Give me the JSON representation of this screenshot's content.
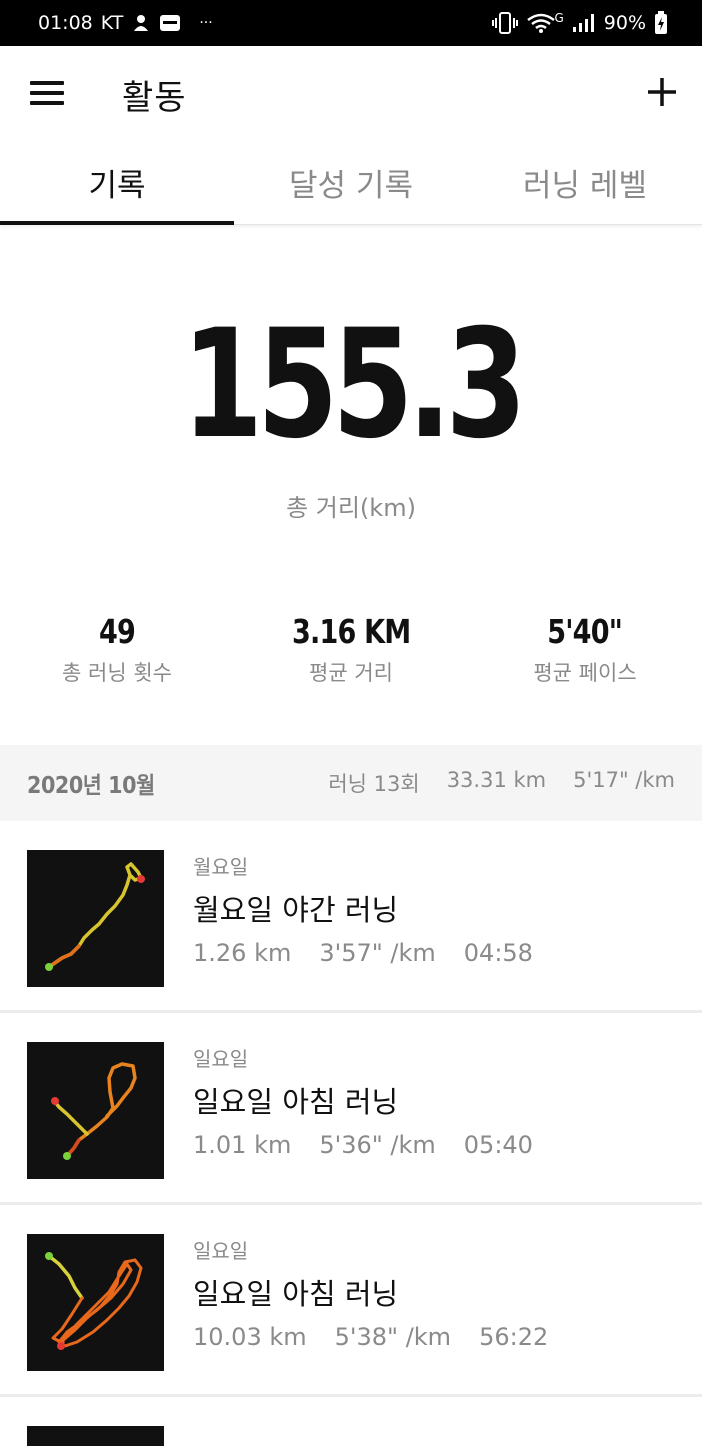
{
  "status_bar": {
    "time": "01:08",
    "carrier": "KT",
    "more": "···",
    "network": "G",
    "battery": "90%"
  },
  "app_bar": {
    "title": "활동"
  },
  "tabs": [
    {
      "label": "기록",
      "active": true
    },
    {
      "label": "달성 기록",
      "active": false
    },
    {
      "label": "러닝 레벨",
      "active": false
    }
  ],
  "summary": {
    "total_distance": "155.3",
    "total_label": "총 거리(km)"
  },
  "stats": [
    {
      "value": "49",
      "label": "총 러닝 횟수"
    },
    {
      "value": "3.16 KM",
      "label": "평균 거리"
    },
    {
      "value": "5'40\"",
      "label": "평균 페이스"
    }
  ],
  "month": {
    "label": "2020년 10월",
    "runs": "러닝 13회",
    "distance": "33.31 km",
    "pace": "5'17\" /km"
  },
  "activities": [
    {
      "day": "월요일",
      "title": "월요일 야간 러닝",
      "distance": "1.26 km",
      "pace": "3'57\" /km",
      "duration": "04:58"
    },
    {
      "day": "일요일",
      "title": "일요일 아침 러닝",
      "distance": "1.01 km",
      "pace": "5'36\" /km",
      "duration": "05:40"
    },
    {
      "day": "일요일",
      "title": "일요일 아침 러닝",
      "distance": "10.03 km",
      "pace": "5'38\" /km",
      "duration": "56:22"
    }
  ],
  "colors": {
    "route_start": "#7bd13b",
    "route_end": "#e53935",
    "route_yellow": "#d8d23a",
    "route_orange": "#e8751f"
  }
}
